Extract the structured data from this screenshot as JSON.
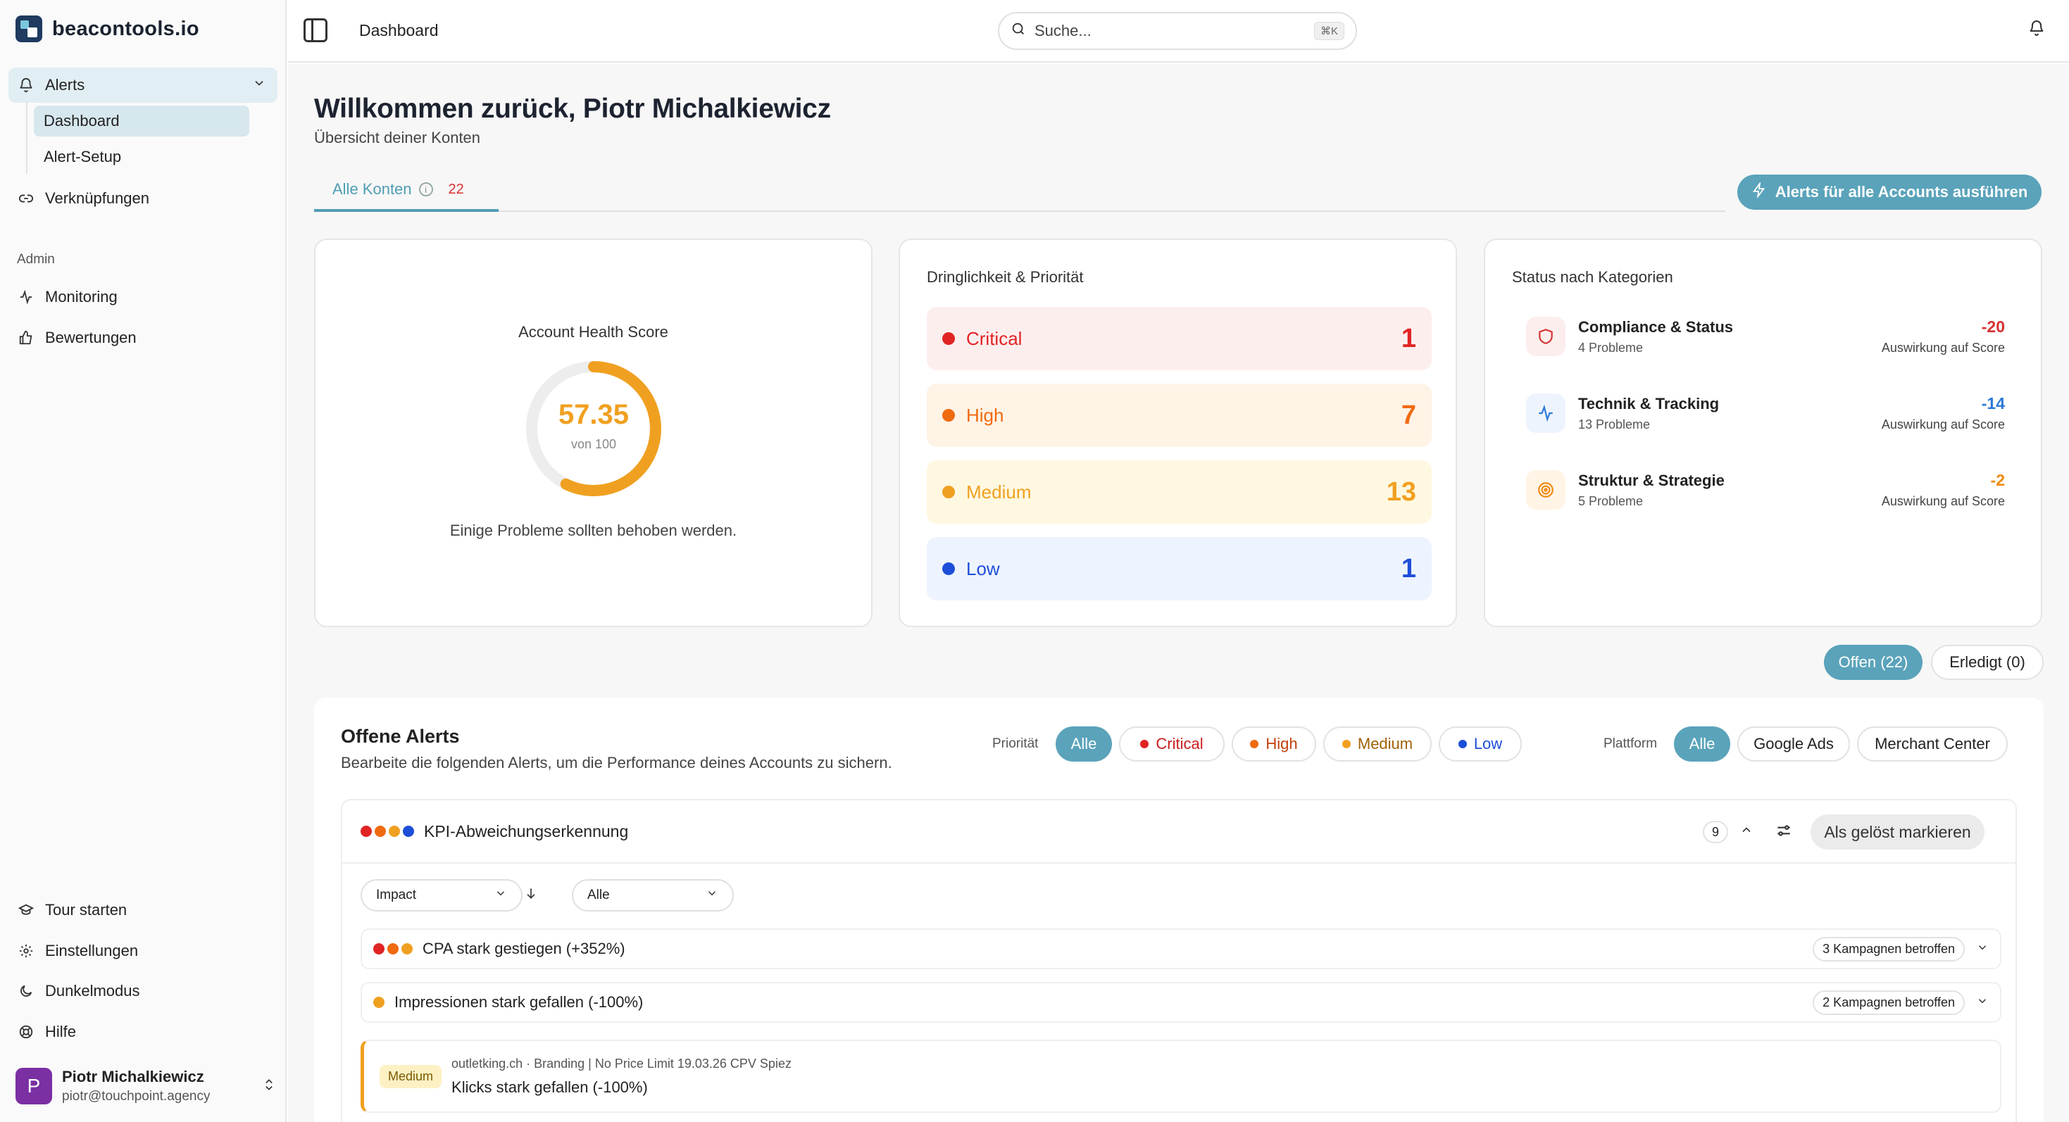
{
  "app": {
    "logo_text": "beacontools.io"
  },
  "sidebar": {
    "alerts_label": "Alerts",
    "sub_items": [
      "Dashboard",
      "Alert-Setup"
    ],
    "links_label": "Verknüpfungen",
    "admin_label": "Admin",
    "admin_items": [
      "Monitoring",
      "Bewertungen"
    ],
    "bottom_items": [
      "Tour starten",
      "Einstellungen",
      "Dunkelmodus",
      "Hilfe"
    ],
    "user": {
      "initial": "P",
      "name": "Piotr Michalkiewicz",
      "email": "piotr@touchpoint.agency"
    }
  },
  "topbar": {
    "breadcrumb": "Dashboard",
    "search_placeholder": "Suche...",
    "shortcut": "⌘K"
  },
  "header": {
    "title": "Willkommen zurück, Piotr Michalkiewicz",
    "subtitle": "Übersicht deiner Konten"
  },
  "tabs": [
    {
      "label": "Alle Konten",
      "count": "22"
    }
  ],
  "run_button": "Alerts für alle Accounts ausführen",
  "health": {
    "title": "Account Health Score",
    "score": "57.35",
    "score_fraction": 0.5735,
    "of": "von 100",
    "message": "Einige Probleme sollten behoben werden."
  },
  "priority": {
    "title": "Dringlichkeit & Priorität",
    "rows": [
      {
        "label": "Critical",
        "count": "1",
        "color": "#e02424",
        "bg": "#fdeeee"
      },
      {
        "label": "High",
        "count": "7",
        "color": "#f06a10",
        "bg": "#fff3e6"
      },
      {
        "label": "Medium",
        "count": "13",
        "color": "#f0a020",
        "bg": "#fff8e1"
      },
      {
        "label": "Low",
        "count": "1",
        "color": "#1d4ed8",
        "bg": "#eef4ff"
      }
    ]
  },
  "categories": {
    "title": "Status nach Kategorien",
    "rows": [
      {
        "name": "Compliance & Status",
        "sub": "4 Probleme",
        "value": "-20",
        "impact": "Auswirkung auf Score",
        "color": "#d63030",
        "icon": "shield-icon"
      },
      {
        "name": "Technik & Tracking",
        "sub": "13 Probleme",
        "value": "-14",
        "impact": "Auswirkung auf Score",
        "color": "#2b78d8",
        "icon": "activity-icon"
      },
      {
        "name": "Struktur & Strategie",
        "sub": "5 Probleme",
        "value": "-2",
        "impact": "Auswirkung auf Score",
        "color": "#f08a10",
        "icon": "target-icon"
      }
    ]
  },
  "state_toggle": {
    "open": "Offen (22)",
    "done": "Erledigt (0)"
  },
  "alerts": {
    "title": "Offene Alerts",
    "subtitle": "Bearbeite die folgenden Alerts, um die Performance deines Accounts zu sichern.",
    "priority_label": "Priorität",
    "priority_filters": [
      "Alle",
      "Critical",
      "High",
      "Medium",
      "Low"
    ],
    "platform_label": "Plattform",
    "platform_filters": [
      "Alle",
      "Google Ads",
      "Merchant Center"
    ],
    "group": {
      "title": "KPI-Abweichungserkennung",
      "count": "9",
      "resolve": "Als gelöst markieren",
      "sort_select": "Impact",
      "filter_select": "Alle",
      "rows": [
        {
          "title": "CPA stark gestiegen (+352%)",
          "badge": "3 Kampagnen betroffen"
        },
        {
          "title": "Impressionen stark gefallen (-100%)",
          "badge": "2 Kampagnen betroffen"
        }
      ],
      "detail": {
        "tag": "Medium",
        "meta": "outletking.ch · Branding | No Price Limit 19.03.26 CPV Spiez",
        "title": "Klicks stark gefallen (-100%)"
      }
    }
  }
}
